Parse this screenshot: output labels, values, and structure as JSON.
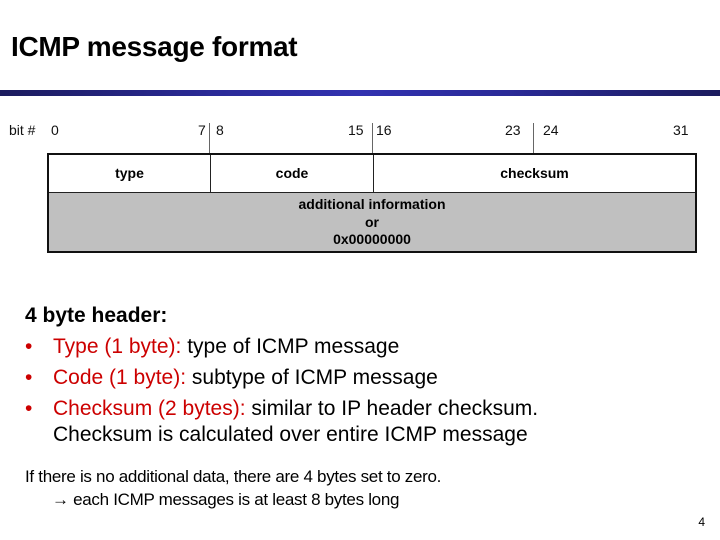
{
  "slide": {
    "title": "ICMP message format",
    "page_number": "4",
    "accent_colors": {
      "rule": "#2a2a98",
      "highlight": "#cc0000",
      "payload_fill": "#c0c0c0"
    }
  },
  "diagram": {
    "bit_label": "bit #",
    "bit_numbers": [
      "0",
      "7",
      "8",
      "15",
      "16",
      "23",
      "24",
      "31"
    ],
    "row1_fields": [
      "type",
      "code",
      "checksum"
    ],
    "row2_lines": [
      "additional information",
      "or",
      "0x00000000"
    ]
  },
  "body": {
    "heading": "4 byte header:",
    "bullets": [
      {
        "term": "Type (1 byte):",
        "desc": " type of ICMP message"
      },
      {
        "term": "Code (1 byte):",
        "desc": " subtype of ICMP message"
      },
      {
        "term": "Checksum (2 bytes):",
        "desc": " similar to IP header checksum.",
        "continuation": "Checksum is calculated over entire ICMP message"
      }
    ],
    "bullet_glyph": "•"
  },
  "note": {
    "line1": "If there is no additional data, there are 4 bytes set to zero.",
    "arrow_icon": "→",
    "line2": " each ICMP messages is at least 8 bytes long"
  }
}
